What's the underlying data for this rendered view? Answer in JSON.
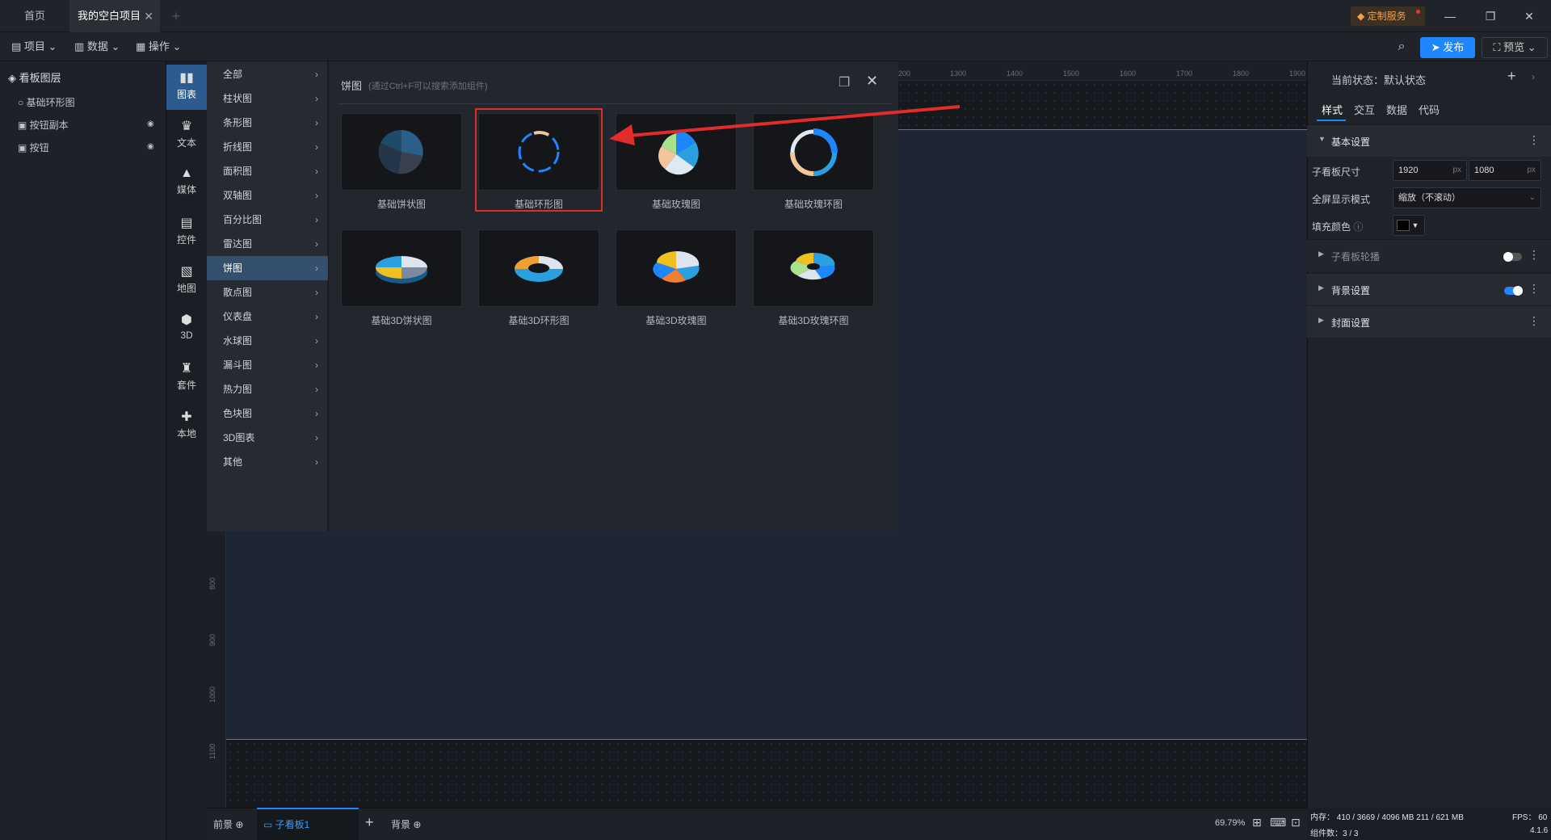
{
  "tabs": {
    "home": "首页",
    "project": "我的空白项目"
  },
  "service_label": "定制服务",
  "toolbar": {
    "project": "项目",
    "data": "数据",
    "operate": "操作",
    "publish": "发布",
    "preview": "预览"
  },
  "layers": {
    "title": "看板图层",
    "items": [
      "基础环形图",
      "按钮副本",
      "按钮"
    ]
  },
  "categories": [
    "图表",
    "文本",
    "媒体",
    "控件",
    "地图",
    "3D",
    "套件",
    "本地"
  ],
  "menu": [
    "全部",
    "柱状图",
    "条形图",
    "折线图",
    "面积图",
    "双轴图",
    "百分比图",
    "雷达图",
    "饼图",
    "散点图",
    "仪表盘",
    "水球图",
    "漏斗图",
    "热力图",
    "色块图",
    "3D图表",
    "其他"
  ],
  "panel": {
    "title": "饼图",
    "hint": "(通过Ctrl+F可以搜索添加组件)",
    "cards": [
      "基础饼状图",
      "基础环形图",
      "基础玫瑰图",
      "基础玫瑰环图",
      "基础3D饼状图",
      "基础3D环形图",
      "基础3D玫瑰图",
      "基础3D玫瑰环图"
    ]
  },
  "ruler_top": [
    "200",
    "1300",
    "1400",
    "1500",
    "1600",
    "1700",
    "1800",
    "1900"
  ],
  "ruler_left": [
    "800",
    "900",
    "1000",
    "1100"
  ],
  "props": {
    "state_label": "当前状态：默认状态",
    "tabs": [
      "样式",
      "交互",
      "数据",
      "代码"
    ],
    "basic": "基本设置",
    "size_label": "子看板尺寸",
    "width": "1920",
    "height": "1080",
    "unit": "px",
    "mode_label": "全屏显示模式",
    "mode_value": "缩放（不滚动）",
    "fill_label": "填充颜色",
    "carousel": "子看板轮播",
    "bg": "背景设置",
    "cover": "封面设置",
    "fill_color": "#000000",
    "accent": "#1e86ff"
  },
  "statusbar": {
    "foreground": "前景",
    "board": "子看板1",
    "background": "背景",
    "zoom": "69.79%"
  },
  "stats": {
    "memory": "内存：  410 / 3669 / 4096 MB  211 / 621 MB",
    "fps": "FPS：  60",
    "components": "组件数：3 / 3",
    "version": "4.1.6"
  }
}
